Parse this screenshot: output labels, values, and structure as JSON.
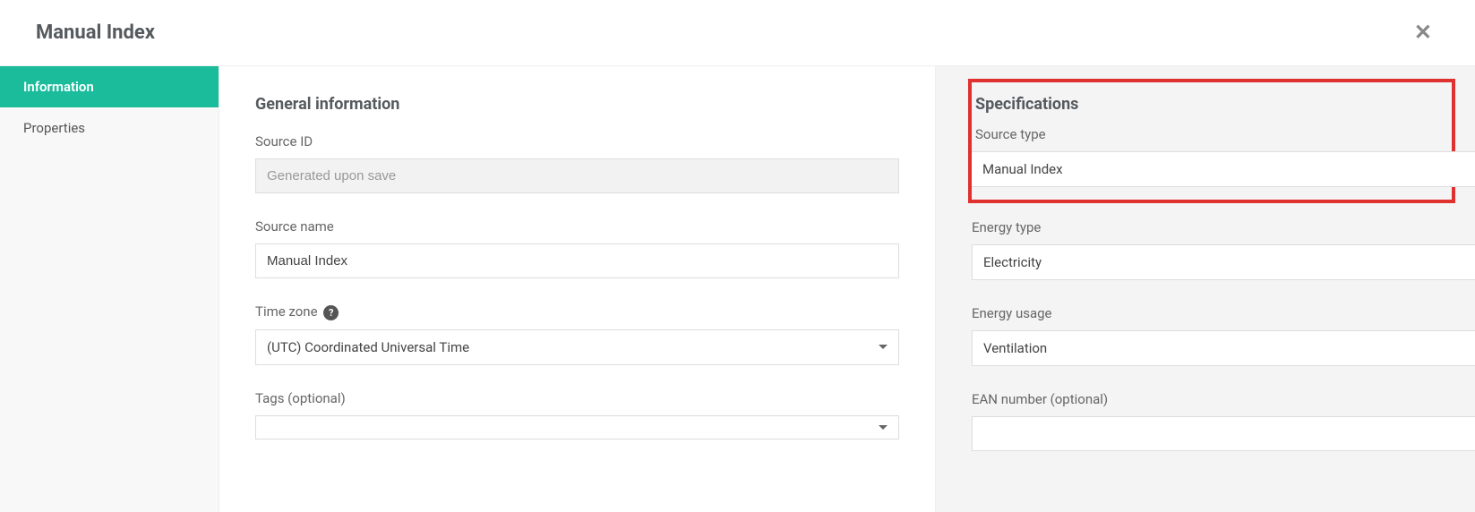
{
  "header": {
    "title": "Manual Index"
  },
  "sidebar": {
    "items": [
      {
        "label": "Information",
        "active": true
      },
      {
        "label": "Properties",
        "active": false
      }
    ]
  },
  "main": {
    "section_title": "General information",
    "source_id": {
      "label": "Source ID",
      "placeholder": "Generated upon save",
      "value": ""
    },
    "source_name": {
      "label": "Source name",
      "value": "Manual Index"
    },
    "time_zone": {
      "label": "Time zone",
      "value": "(UTC) Coordinated Universal Time"
    },
    "tags": {
      "label": "Tags (optional)",
      "value": ""
    }
  },
  "specs": {
    "section_title": "Specifications",
    "source_type": {
      "label": "Source type",
      "value": "Manual Index"
    },
    "energy_type": {
      "label": "Energy type",
      "value": "Electricity"
    },
    "energy_usage": {
      "label": "Energy usage",
      "value": "Ventilation"
    },
    "ean_number": {
      "label": "EAN number (optional)",
      "value": ""
    }
  }
}
